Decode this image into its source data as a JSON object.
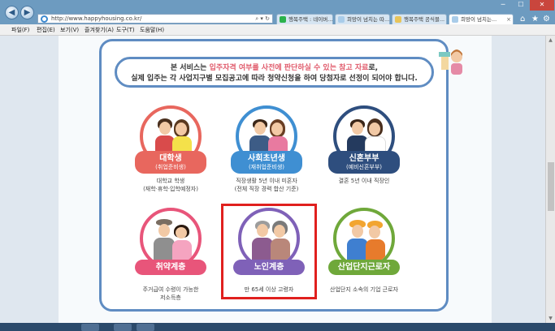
{
  "browser": {
    "url": "http://www.happyhousing.co.kr/",
    "tabs": [
      {
        "label": "행복주택 : 네이버...",
        "color": "#2bb24c"
      },
      {
        "label": "희망이 넘치는 따...",
        "color": "#a9cce9"
      },
      {
        "label": "행복주택 공식블...",
        "color": "#e8c45a"
      },
      {
        "label": "희망이 넘치는...",
        "color": "#a9cce9"
      }
    ],
    "window_controls": {
      "minimize": "─",
      "maximize": "☐",
      "close": "✕"
    },
    "back": "◀",
    "forward": "▶",
    "addr_tools": "⌕ ▾ ↻",
    "chrome_icons": [
      "⌂",
      "★",
      "⚙"
    ]
  },
  "menu": [
    "파일(F)",
    "편집(E)",
    "보기(V)",
    "즐겨찾기(A)",
    "도구(T)",
    "도움말(H)"
  ],
  "notice": {
    "line1_pre": "본 서비스는 ",
    "line1_hl": "입주자격 여부를 사전에 판단하실 수 있는 참고 자료",
    "line1_post": "로,",
    "line2": "실제 입주는 각 사업지구별 모집공고에 따라 청약신청을 하여 당첨자로 선정이 되어야 합니다."
  },
  "cards": [
    {
      "title": "대학생",
      "sub": "(취업준비생)",
      "desc1": "대학교 학생",
      "desc2": "(재학·휴학·입학예정자)",
      "color": "#e8675e"
    },
    {
      "title": "사회초년생",
      "sub": "(재취업준비생)",
      "desc1": "직장생활 5년 이내 미혼자",
      "desc2": "(전체 직장 경력 합산 기준)",
      "color": "#3f8fd2"
    },
    {
      "title": "신혼부부",
      "sub": "(예비신혼부부)",
      "desc1": "결혼 5년 이내 직장인",
      "desc2": "",
      "color": "#2e4e7e"
    },
    {
      "title": "취약계층",
      "sub": "",
      "desc1": "주거급여 수령이 가능한",
      "desc2": "저소득층",
      "color": "#e8557a"
    },
    {
      "title": "노인계층",
      "sub": "",
      "desc1": "만 65세 이상 고령자",
      "desc2": "",
      "color": "#7f61b8"
    },
    {
      "title": "산업단지근로자",
      "sub": "",
      "desc1": "산업단지 소속의 기업 근로자",
      "desc2": "",
      "color": "#6fa83a"
    }
  ],
  "colors": {
    "frame": "#5f8cc2",
    "highlight": "#e0201e",
    "notice_highlight": "#e05a6b"
  }
}
